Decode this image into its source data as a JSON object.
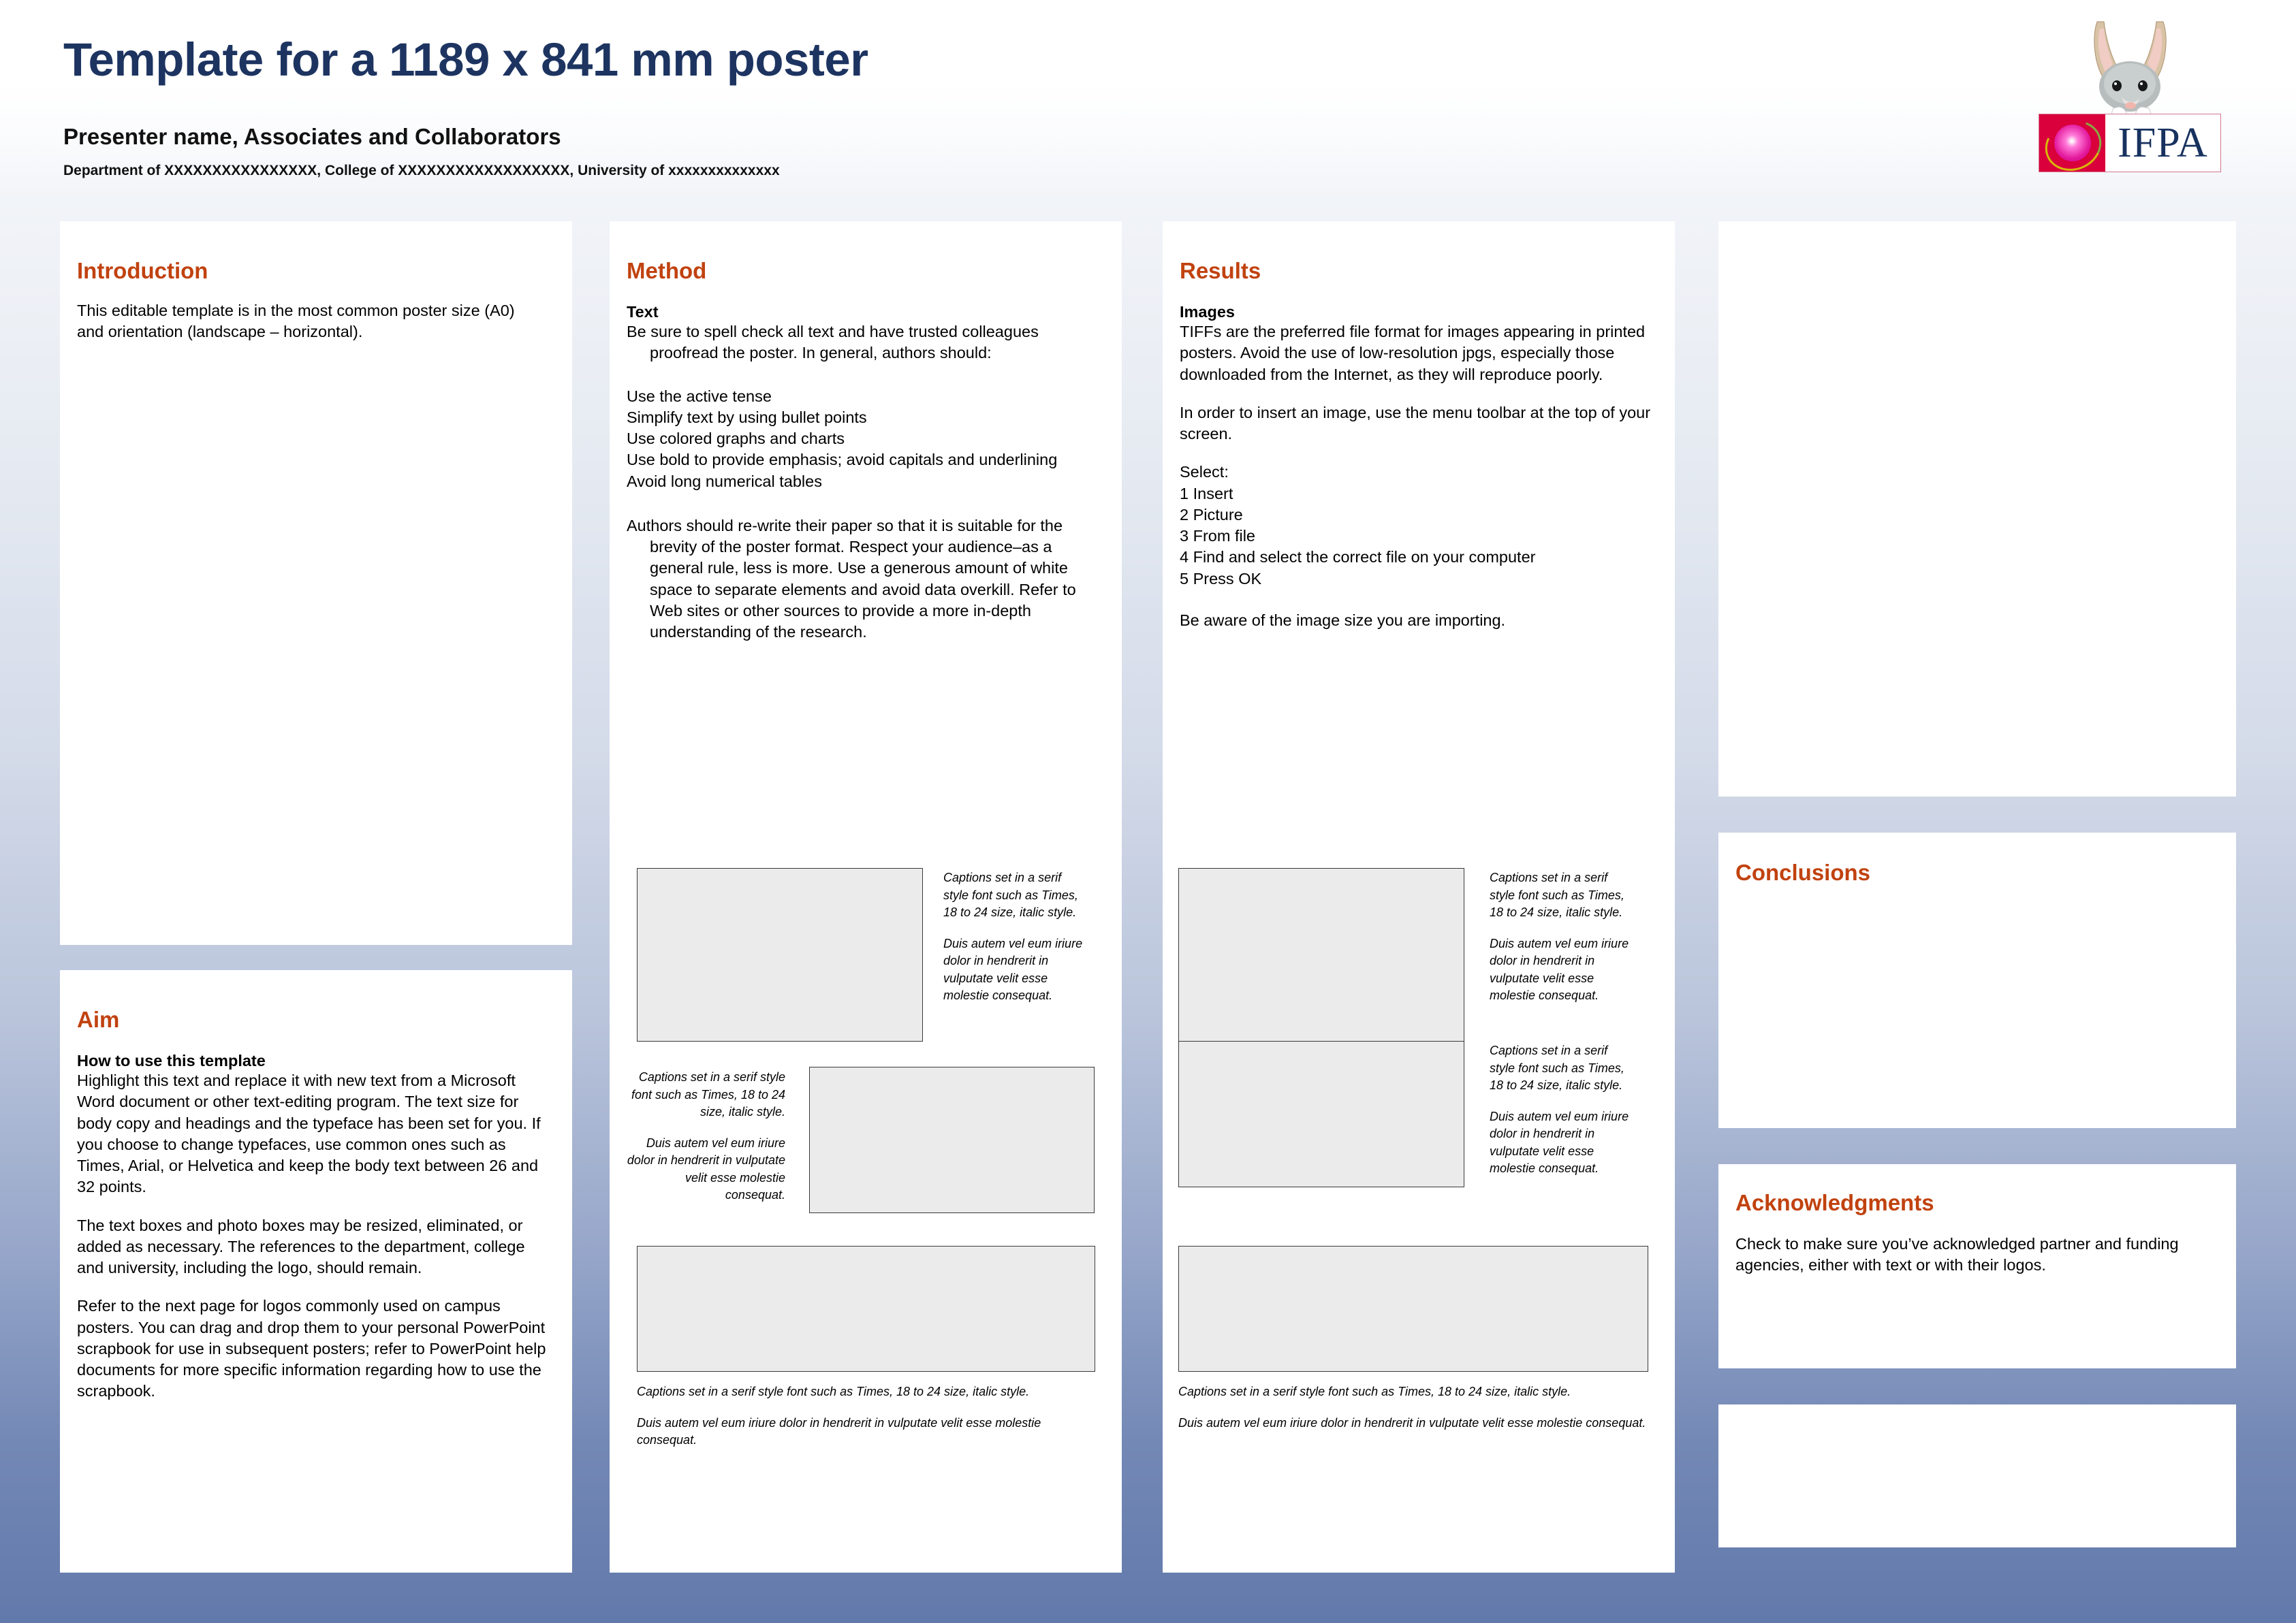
{
  "header": {
    "title": "Template for a 1189 x 841 mm poster",
    "presenter": "Presenter name, Associates and Collaborators",
    "affiliation": "Department of XXXXXXXXXXXXXXXX, College of XXXXXXXXXXXXXXXXXX, University of xxxxxxxxxxxxxx",
    "logo_text": "IFPA"
  },
  "colors": {
    "heading": "#c1420f",
    "title": "#1d3461",
    "logo_red": "#d9003c",
    "logo_navy": "#18325f",
    "background_bottom": "#6279ab"
  },
  "introduction": {
    "heading": "Introduction",
    "body": "This editable template is in the most common poster size (A0) and orientation (landscape – horizontal)."
  },
  "aim": {
    "heading": "Aim",
    "sub_heading": "How to use this template",
    "para1": "Highlight this text and replace it with new text from a Microsoft Word document or other text-editing program. The text size for body copy and headings and the typeface has been set for you. If you choose to change typefaces, use common ones such as Times, Arial, or Helvetica and keep the body text between 26 and 32 points.",
    "para2": "The text boxes and photo boxes may be resized, eliminated, or added as necessary. The references to the department, college and university, including the logo, should remain.",
    "para3": "Refer to the next page for logos commonly used on campus posters.  You can drag and drop them to your personal PowerPoint scrapbook for use in subsequent posters; refer to PowerPoint help documents for more specific information regarding how to use the scrapbook."
  },
  "method": {
    "heading": "Method",
    "sub_heading": "Text",
    "intro": "Be sure to spell check all text and have trusted colleagues proofread the poster. In general, authors should:",
    "bullets": [
      "Use the active tense",
      "Simplify text by using bullet points",
      "Use colored graphs and charts",
      "Use bold to provide emphasis; avoid capitals and underlining",
      "Avoid long numerical tables"
    ],
    "closing": "Authors should re-write their paper so that it is suitable for the brevity of the poster format. Respect your audience–as a general rule, less is more. Use a generous amount of white space to separate elements and avoid data overkill. Refer to Web sites or other sources to provide a more in-depth understanding of the research."
  },
  "results": {
    "heading": "Results",
    "sub_heading": "Images",
    "para1": "TIFFs are the preferred file format for images appearing in printed posters. Avoid the use of low-resolution jpgs, especially those downloaded from the Internet, as they will reproduce poorly.",
    "para2": "In order to insert an image, use the menu toolbar at the top of your screen.",
    "select_label": "Select:",
    "steps": [
      "1  Insert",
      "2  Picture",
      "3  From file",
      "4  Find and select the correct file on your computer",
      "5  Press OK"
    ],
    "para3": "Be aware of the image size you are importing."
  },
  "conclusions": {
    "heading": "Conclusions",
    "body": ""
  },
  "acknowledgments": {
    "heading": "Acknowledgments",
    "body": "Check to make sure you’ve acknowledged partner and funding agencies, either with text or with their logos."
  },
  "captions": {
    "line1": "Captions set in a serif style font such as Times, 18 to 24 size, italic style.",
    "line2": "Duis autem vel eum iriure dolor in hendrerit in vulputate velit esse molestie consequat."
  }
}
